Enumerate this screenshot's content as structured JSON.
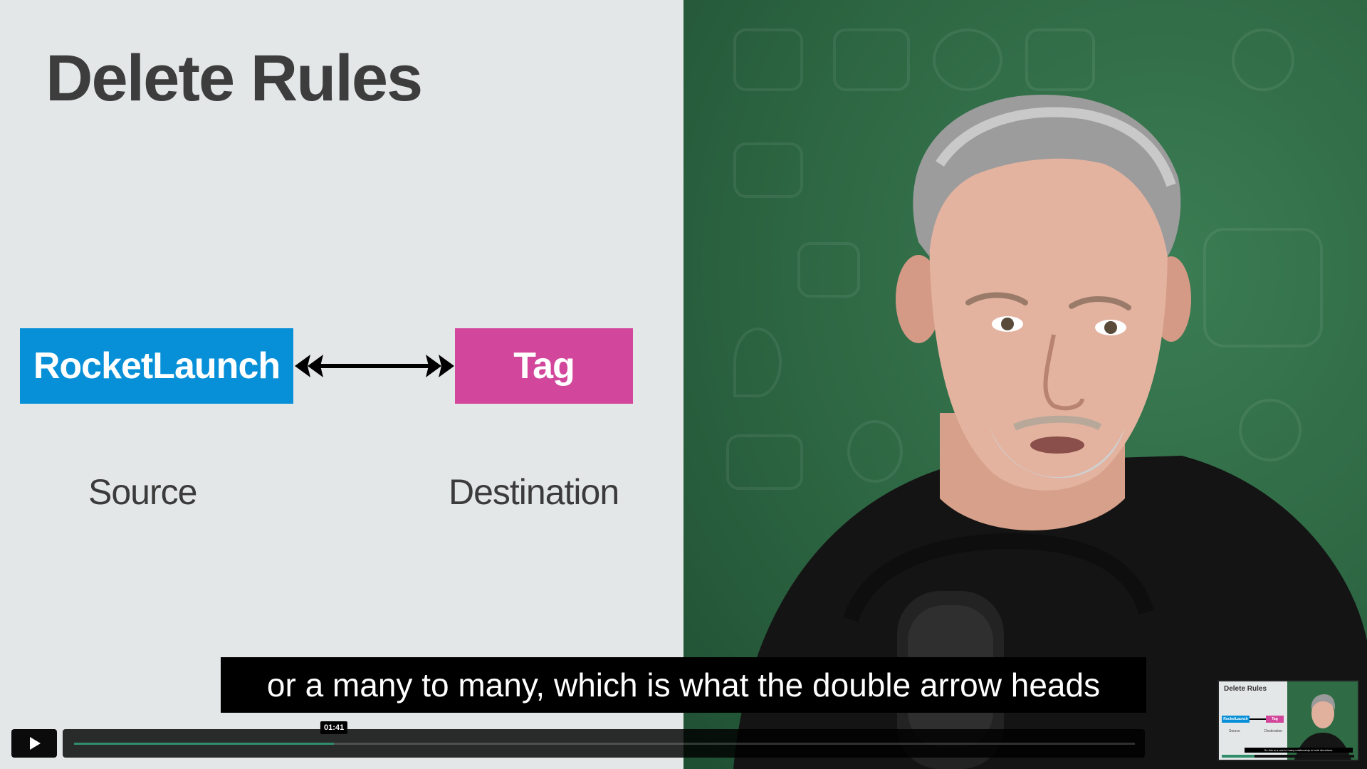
{
  "slide": {
    "title": "Delete Rules",
    "source_entity": "RocketLaunch",
    "destination_entity": "Tag",
    "source_role": "Source",
    "destination_role": "Destination",
    "colors": {
      "background": "#e4e7e8",
      "source": "#0790d8",
      "destination": "#d2479b",
      "text": "#3d3d3d"
    }
  },
  "caption": {
    "text": "or a many to many, which is what the double arrow heads"
  },
  "player": {
    "play_icon": "play-icon",
    "hover_time": "01:41",
    "progress": 0.245,
    "accent_color": "#2f8d6a"
  },
  "thumbnail": {
    "title": "Delete Rules",
    "source_entity": "RocketLaunch",
    "destination_entity": "Tag",
    "source_role": "Source",
    "destination_role": "Destination",
    "caption": "So this is a one to many relationship in both directions."
  }
}
